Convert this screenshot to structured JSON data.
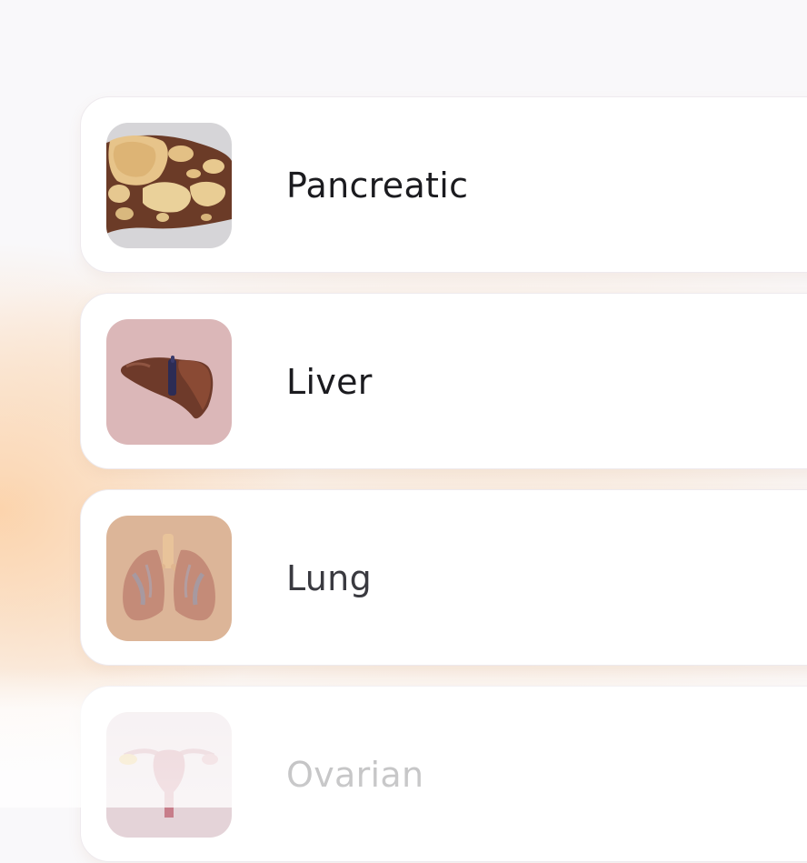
{
  "list": {
    "items": [
      {
        "label": "Pancreatic",
        "icon": "pancreas-image"
      },
      {
        "label": "Liver",
        "icon": "liver-image"
      },
      {
        "label": "Lung",
        "icon": "lungs-image"
      },
      {
        "label": "Ovarian",
        "icon": "uterus-ovaries-image"
      }
    ]
  },
  "colors": {
    "card_background": "#ffffff",
    "glow": "#fccea0",
    "text": "#1b1b1f"
  }
}
